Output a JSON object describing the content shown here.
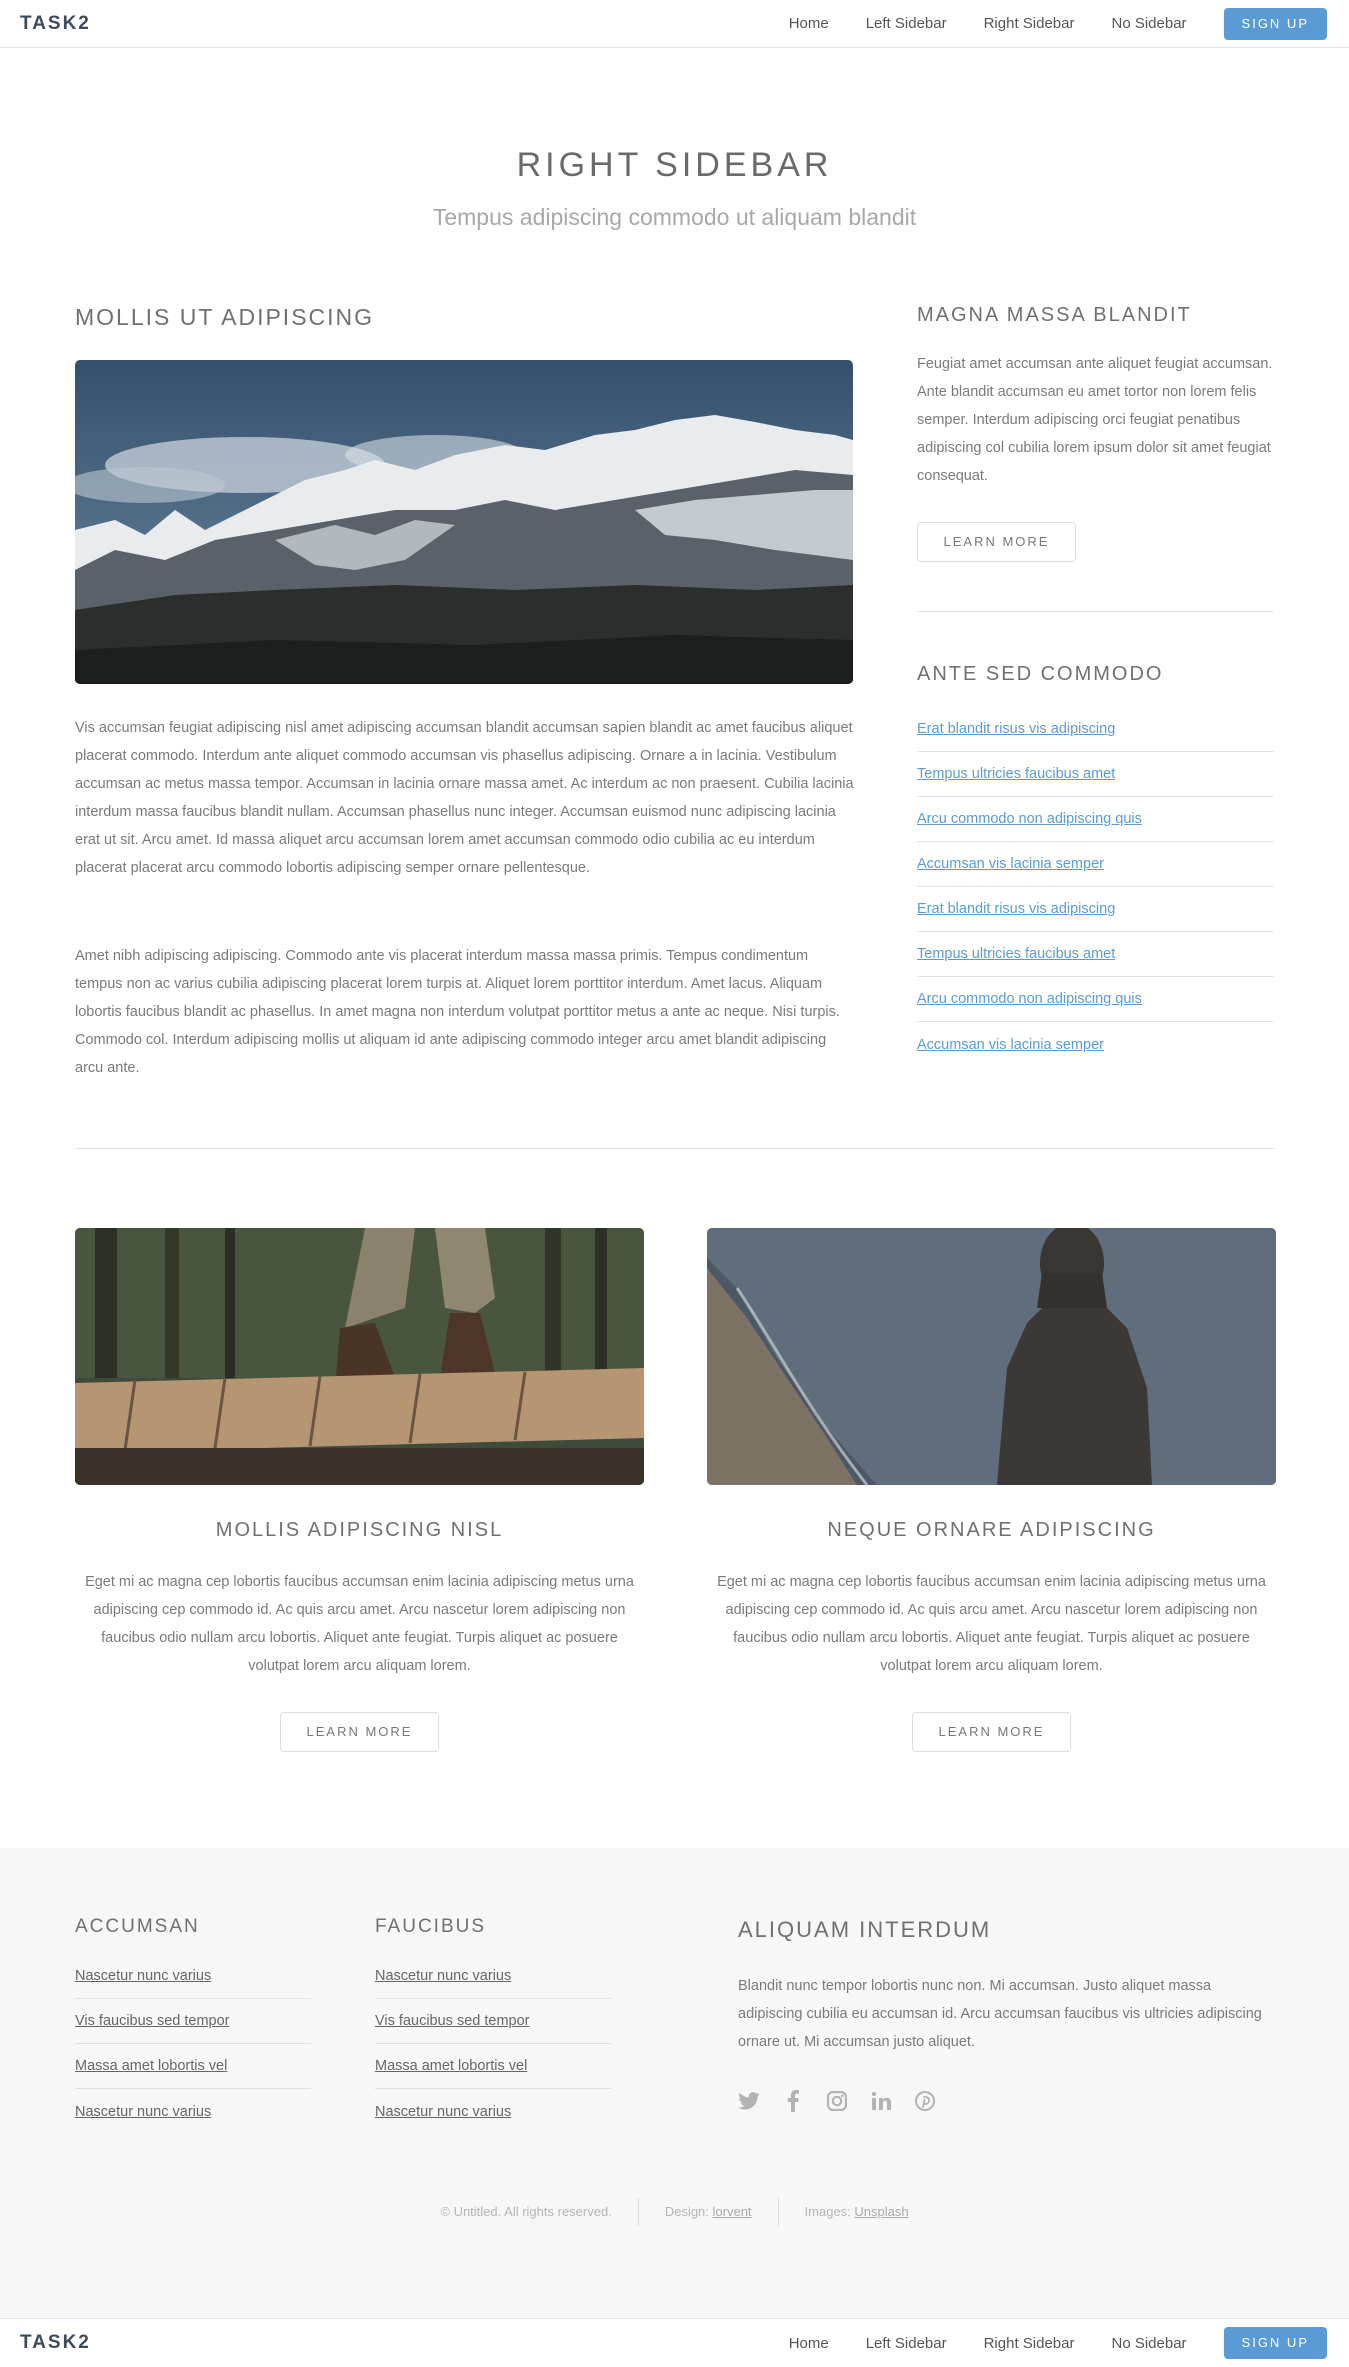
{
  "brand": "TASK2",
  "nav": {
    "links": [
      "Home",
      "Left Sidebar",
      "Right Sidebar",
      "No Sidebar"
    ],
    "signup": "SIGN UP"
  },
  "page": {
    "title": "RIGHT SIDEBAR",
    "subtitle": "Tempus adipiscing commodo ut aliquam blandit"
  },
  "main": {
    "heading": "MOLLIS UT ADIPISCING",
    "paragraph1": "Vis accumsan feugiat adipiscing nisl amet adipiscing accumsan blandit accumsan sapien blandit ac amet faucibus aliquet placerat commodo. Interdum ante aliquet commodo accumsan vis phasellus adipiscing. Ornare a in lacinia. Vestibulum accumsan ac metus massa tempor. Accumsan in lacinia ornare massa amet. Ac interdum ac non praesent. Cubilia lacinia interdum massa faucibus blandit nullam. Accumsan phasellus nunc integer. Accumsan euismod nunc adipiscing lacinia erat ut sit. Arcu amet. Id massa aliquet arcu accumsan lorem amet accumsan commodo odio cubilia ac eu interdum placerat placerat arcu commodo lobortis adipiscing semper ornare pellentesque.",
    "paragraph2": "Amet nibh adipiscing adipiscing. Commodo ante vis placerat interdum massa massa primis. Tempus condimentum tempus non ac varius cubilia adipiscing placerat lorem turpis at. Aliquet lorem porttitor interdum. Amet lacus. Aliquam lobortis faucibus blandit ac phasellus. In amet magna non interdum volutpat porttitor metus a ante ac neque. Nisi turpis. Commodo col. Interdum adipiscing mollis ut aliquam id ante adipiscing commodo integer arcu amet blandit adipiscing arcu ante."
  },
  "sidebar": {
    "heading1": "MAGNA MASSA BLANDIT",
    "paragraph": "Feugiat amet accumsan ante aliquet feugiat accumsan. Ante blandit accumsan eu amet tortor non lorem felis semper. Interdum adipiscing orci feugiat penatibus adipiscing col cubilia lorem ipsum dolor sit amet feugiat consequat.",
    "learn_more": "LEARN MORE",
    "heading2": "ANTE SED COMMODO",
    "links": [
      "Erat blandit risus vis adipiscing",
      "Tempus ultricies faucibus amet",
      "Arcu commodo non adipiscing quis",
      "Accumsan vis lacinia semper",
      "Erat blandit risus vis adipiscing",
      "Tempus ultricies faucibus amet",
      "Arcu commodo non adipiscing quis",
      "Accumsan vis lacinia semper"
    ]
  },
  "cards": [
    {
      "title": "MOLLIS ADIPISCING NISL",
      "text": "Eget mi ac magna cep lobortis faucibus accumsan enim lacinia adipiscing metus urna adipiscing cep commodo id. Ac quis arcu amet. Arcu nascetur lorem adipiscing non faucibus odio nullam arcu lobortis. Aliquet ante feugiat. Turpis aliquet ac posuere volutpat lorem arcu aliquam lorem.",
      "button": "LEARN MORE"
    },
    {
      "title": "NEQUE ORNARE ADIPISCING",
      "text": "Eget mi ac magna cep lobortis faucibus accumsan enim lacinia adipiscing metus urna adipiscing cep commodo id. Ac quis arcu amet. Arcu nascetur lorem adipiscing non faucibus odio nullam arcu lobortis. Aliquet ante feugiat. Turpis aliquet ac posuere volutpat lorem arcu aliquam lorem.",
      "button": "LEARN MORE"
    }
  ],
  "footer": {
    "col1": {
      "heading": "ACCUMSAN",
      "links": [
        "Nascetur nunc varius",
        "Vis faucibus sed tempor",
        "Massa amet lobortis vel",
        "Nascetur nunc varius"
      ]
    },
    "col2": {
      "heading": "FAUCIBUS",
      "links": [
        "Nascetur nunc varius",
        "Vis faucibus sed tempor",
        "Massa amet lobortis vel",
        "Nascetur nunc varius"
      ]
    },
    "col3": {
      "heading": "ALIQUAM INTERDUM",
      "paragraph": "Blandit nunc tempor lobortis nunc non. Mi accumsan. Justo aliquet massa adipiscing cubilia eu accumsan id. Arcu accumsan faucibus vis ultricies adipiscing ornare ut. Mi accumsan justo aliquet."
    },
    "social_icons": [
      "twitter-icon",
      "facebook-icon",
      "instagram-icon",
      "linkedin-icon",
      "pinterest-icon"
    ],
    "copyright": "© Untitled. All rights reserved.",
    "design_label": "Design:",
    "design_link": "lorvent",
    "images_label": "Images:",
    "images_link": "Unsplash"
  },
  "colors": {
    "accent": "#5a9bd5",
    "footer_bg": "#f7f7f7",
    "brand": "#3d4a5c"
  }
}
